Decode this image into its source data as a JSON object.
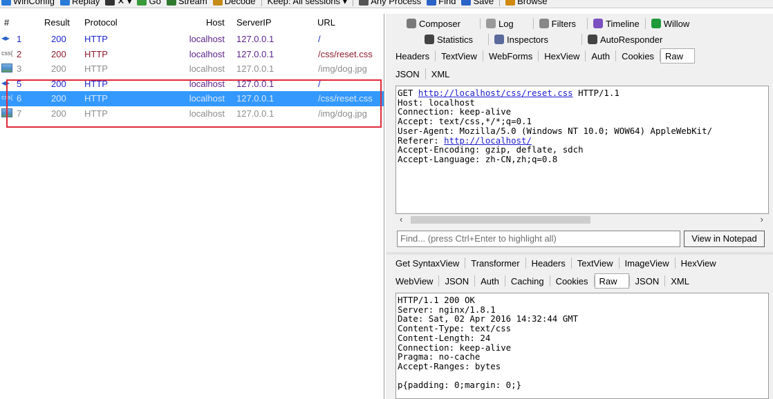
{
  "toolbar": {
    "items": [
      {
        "label": "WinConfig",
        "icon": "windows-icon"
      },
      {
        "label": "Replay",
        "icon": "replay-icon"
      },
      {
        "label": "✕ ▾",
        "icon": "remove-icon"
      },
      {
        "label": "Go",
        "icon": "go-icon"
      },
      {
        "label": "Stream",
        "icon": "stream-icon"
      },
      {
        "label": "Decode",
        "icon": "decode-icon"
      },
      {
        "label": "Keep: All sessions ▾",
        "icon": ""
      },
      {
        "label": "Any Process",
        "icon": "target-icon"
      },
      {
        "label": "Find",
        "icon": "find-icon"
      },
      {
        "label": "Save",
        "icon": "save-icon"
      },
      {
        "label": "Browse",
        "icon": "browse-icon"
      }
    ]
  },
  "sessions": {
    "headers": {
      "num": "#",
      "result": "Result",
      "protocol": "Protocol",
      "host": "Host",
      "server_ip": "ServerIP",
      "url": "URL"
    },
    "rows": [
      {
        "num": "1",
        "result": "200",
        "protocol": "HTTP",
        "host": "localhost",
        "server_ip": "127.0.0.1",
        "url": "/",
        "icon": "html-icon",
        "icon_text": "◂▸",
        "style": "blue"
      },
      {
        "num": "2",
        "result": "200",
        "protocol": "HTTP",
        "host": "localhost",
        "server_ip": "127.0.0.1",
        "url": "/css/reset.css",
        "icon": "css-icon",
        "icon_text": "css{",
        "style": "css"
      },
      {
        "num": "3",
        "result": "200",
        "protocol": "HTTP",
        "host": "localhost",
        "server_ip": "127.0.0.1",
        "url": "/img/dog.jpg",
        "icon": "image-icon",
        "icon_text": "",
        "style": "gray"
      },
      {
        "num": "5",
        "result": "200",
        "protocol": "HTTP",
        "host": "localhost",
        "server_ip": "127.0.0.1",
        "url": "/",
        "icon": "html-icon",
        "icon_text": "◂▸",
        "style": "blue"
      },
      {
        "num": "6",
        "result": "200",
        "protocol": "HTTP",
        "host": "localhost",
        "server_ip": "127.0.0.1",
        "url": "/css/reset.css",
        "icon": "css-icon",
        "icon_text": "css{",
        "style": "sel"
      },
      {
        "num": "7",
        "result": "200",
        "protocol": "HTTP",
        "host": "localhost",
        "server_ip": "127.0.0.1",
        "url": "/img/dog.jpg",
        "icon": "image-icon",
        "icon_text": "",
        "style": "gray"
      }
    ]
  },
  "main_tabs": {
    "row1": [
      "Composer",
      "Log",
      "Filters",
      "Timeline",
      "Willow"
    ],
    "row2": [
      "Statistics",
      "Inspectors",
      "AutoResponder"
    ]
  },
  "request": {
    "tabs_row1": [
      "Headers",
      "TextView",
      "WebForms",
      "HexView",
      "Auth",
      "Cookies",
      "Raw"
    ],
    "tabs_row2": [
      "JSON",
      "XML"
    ],
    "method": "GET ",
    "url": "http://localhost/css/reset.css",
    "version": " HTTP/1.1",
    "lines": [
      "Host: localhost",
      "Connection: keep-alive",
      "Accept: text/css,*/*;q=0.1",
      "User-Agent: Mozilla/5.0 (Windows NT 10.0; WOW64) AppleWebKit/"
    ],
    "referer_label": "Referer: ",
    "referer_url": "http://localhost/",
    "lines2": [
      "Accept-Encoding: gzip, deflate, sdch",
      "Accept-Language: zh-CN,zh;q=0.8"
    ],
    "find_placeholder": "Find... (press Ctrl+Enter to highlight all)",
    "notepad_label": "View in Notepad"
  },
  "response": {
    "tabs_row1": [
      "Get SyntaxView",
      "Transformer",
      "Headers",
      "TextView",
      "ImageView",
      "HexView"
    ],
    "tabs_row2": [
      "WebView",
      "JSON",
      "Auth",
      "Caching",
      "Cookies",
      "Raw",
      "JSON",
      "XML"
    ],
    "body": "HTTP/1.1 200 OK\nServer: nginx/1.8.1\nDate: Sat, 02 Apr 2016 14:32:44 GMT\nContent-Type: text/css\nContent-Length: 24\nConnection: keep-alive\nPragma: no-cache\nAccept-Ranges: bytes\n\np{padding: 0;margin: 0;}"
  }
}
